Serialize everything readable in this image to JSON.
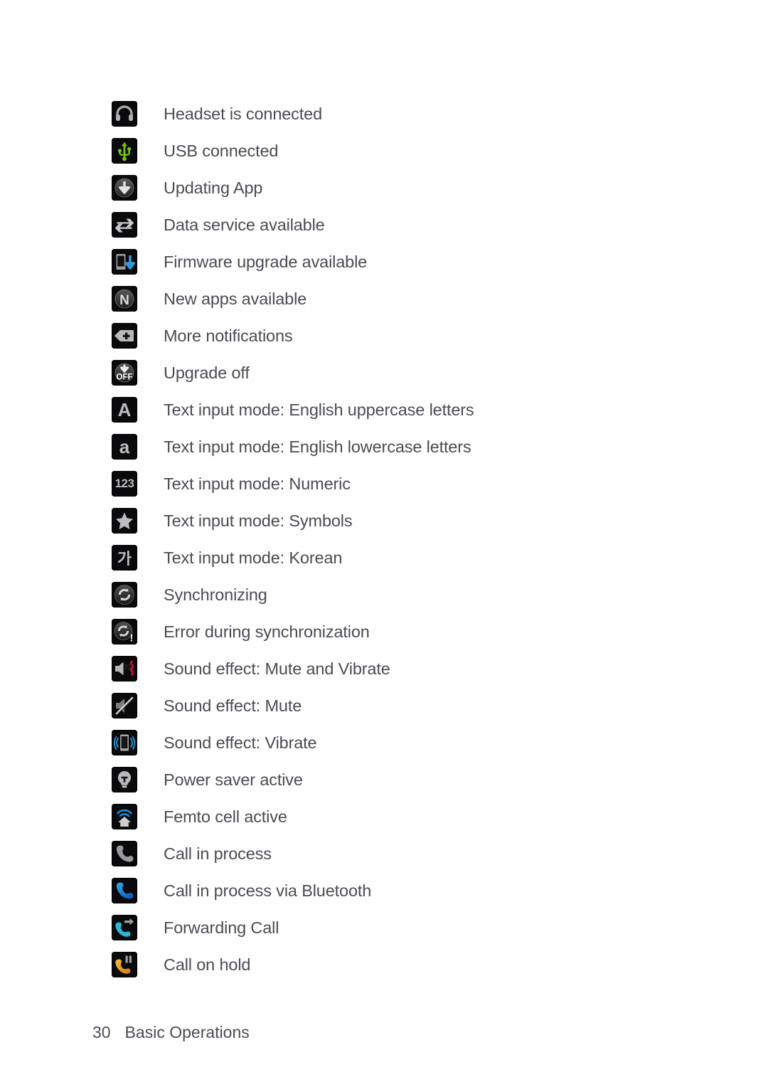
{
  "page": {
    "number": "30",
    "section": "Basic Operations"
  },
  "rows": [
    {
      "icon": "headset-icon",
      "label": "Headset is connected"
    },
    {
      "icon": "usb-icon",
      "label": "USB connected"
    },
    {
      "icon": "download-circle-icon",
      "label": "Updating App"
    },
    {
      "icon": "data-sync-arrows-icon",
      "label": "Data service available"
    },
    {
      "icon": "firmware-upgrade-icon",
      "label": "Firmware upgrade available"
    },
    {
      "icon": "new-apps-n-icon",
      "label": "New apps available"
    },
    {
      "icon": "more-notifications-icon",
      "label": "More notifications"
    },
    {
      "icon": "upgrade-off-icon",
      "label": "Upgrade off"
    },
    {
      "icon": "uppercase-a-icon",
      "label": "Text input mode: English uppercase letters"
    },
    {
      "icon": "lowercase-a-icon",
      "label": "Text input mode: English lowercase letters"
    },
    {
      "icon": "numeric-123-icon",
      "label": "Text input mode: Numeric"
    },
    {
      "icon": "symbols-star-icon",
      "label": "Text input mode: Symbols"
    },
    {
      "icon": "korean-ga-icon",
      "label": "Text input mode: Korean"
    },
    {
      "icon": "sync-icon",
      "label": "Synchronizing"
    },
    {
      "icon": "sync-error-icon",
      "label": "Error during synchronization"
    },
    {
      "icon": "mute-and-vibrate-icon",
      "label": "Sound effect: Mute and Vibrate"
    },
    {
      "icon": "mute-icon",
      "label": "Sound effect: Mute"
    },
    {
      "icon": "vibrate-icon",
      "label": "Sound effect: Vibrate"
    },
    {
      "icon": "power-saver-bulb-icon",
      "label": "Power saver active"
    },
    {
      "icon": "femto-cell-home-icon",
      "label": "Femto cell active"
    },
    {
      "icon": "call-in-process-icon",
      "label": "Call in process"
    },
    {
      "icon": "call-bluetooth-icon",
      "label": "Call in process via Bluetooth"
    },
    {
      "icon": "forwarding-call-icon",
      "label": "Forwarding Call"
    },
    {
      "icon": "call-on-hold-icon",
      "label": "Call on hold"
    }
  ],
  "glyphs": {
    "uppercase_a": "A",
    "lowercase_a": "a",
    "numeric": "123",
    "korean": "가",
    "off": "OFF"
  },
  "colors": {
    "icon_background": "#0a0a0c",
    "text": "#4b4b53",
    "usb_green": "#76c314",
    "firmware_blue": "#2e9bd6",
    "vibrate_blue": "#1f8fd6",
    "femto_blue": "#1b8ad6",
    "mute_vibrate_red": "#c8103c",
    "call_gray": "#9a9a9a",
    "call_bluetooth": "#1175d6",
    "call_forward": "#29b6d8",
    "call_hold_orange": "#e59a1e",
    "glyph_gray": "#bdbdbd",
    "page_background": "#ffffff"
  }
}
